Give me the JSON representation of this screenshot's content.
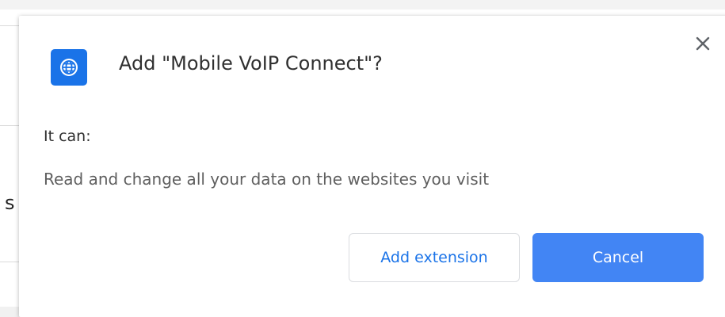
{
  "background": {
    "partial_text": "s"
  },
  "dialog": {
    "icon": "globe-icon",
    "title": "Add \"Mobile VoIP Connect\"?",
    "close_icon": "close-icon",
    "permissions_heading": "It can:",
    "permissions": [
      "Read and change all your data on the websites you visit"
    ],
    "add_button_label": "Add extension",
    "cancel_button_label": "Cancel"
  },
  "colors": {
    "accent": "#1a73e8",
    "primary_button": "#4285f4",
    "icon_background": "#1a73e8"
  }
}
